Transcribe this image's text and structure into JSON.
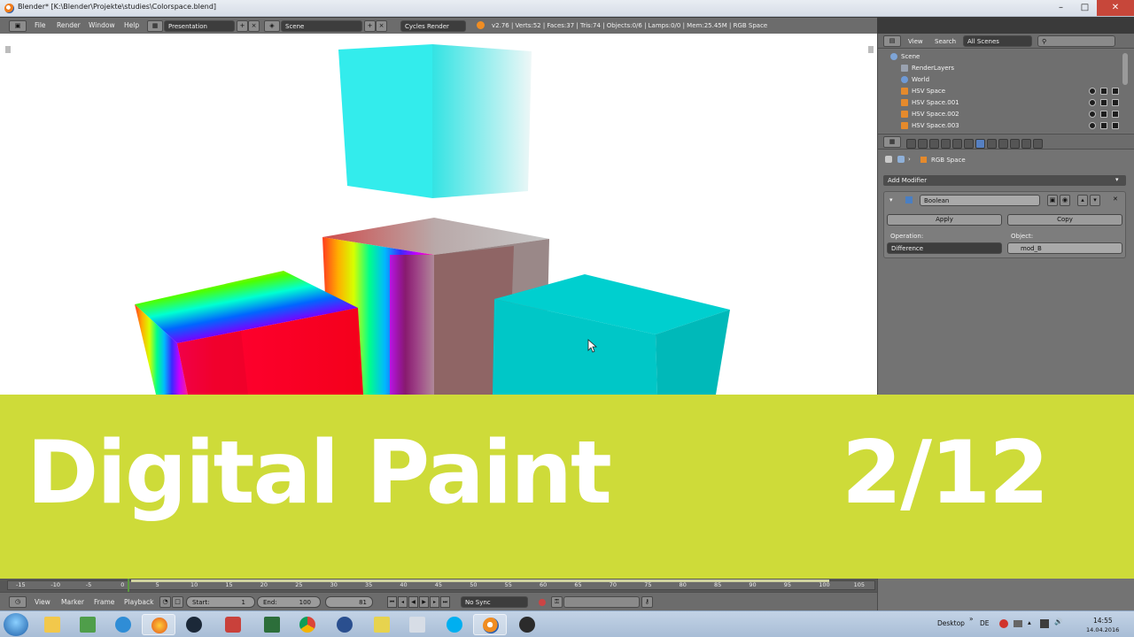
{
  "window": {
    "title": "Blender* [K:\\Blender\\Projekte\\studies\\Colorspace.blend]",
    "minimize": "–",
    "maximize": "□",
    "close": "✕"
  },
  "header": {
    "menus": [
      "File",
      "Render",
      "Window",
      "Help"
    ],
    "screen_layout": "Presentation",
    "scene": "Scene",
    "render_engine": "Cycles Render",
    "stats": "v2.76 | Verts:52 | Faces:37 | Tris:74 | Objects:0/6 | Lamps:0/0 | Mem:25.45M | RGB Space"
  },
  "outliner": {
    "menus": [
      "View",
      "Search"
    ],
    "filter": "All Scenes",
    "search_placeholder": "",
    "items": [
      {
        "label": "Scene",
        "indent": 0
      },
      {
        "label": "RenderLayers",
        "indent": 1
      },
      {
        "label": "World",
        "indent": 1
      },
      {
        "label": "HSV Space",
        "indent": 1
      },
      {
        "label": "HSV Space.001",
        "indent": 1
      },
      {
        "label": "HSV Space.002",
        "indent": 1
      },
      {
        "label": "HSV Space.003",
        "indent": 1
      }
    ]
  },
  "properties": {
    "context_object": "RGB Space",
    "add_modifier": "Add Modifier",
    "modifier_name": "Boolean",
    "apply": "Apply",
    "copy": "Copy",
    "operation_label": "Operation:",
    "operation_value": "Difference",
    "object_label": "Object:",
    "object_value": "mod_B"
  },
  "banner": {
    "title": "Digital Paint",
    "counter": "2/12",
    "color": "#cedb39"
  },
  "timeline": {
    "ticks": [
      "-15",
      "-10",
      "-5",
      "0",
      "5",
      "10",
      "15",
      "20",
      "25",
      "30",
      "35",
      "40",
      "45",
      "50",
      "55",
      "60",
      "65",
      "70",
      "75",
      "80",
      "85",
      "90",
      "95",
      "100",
      "105"
    ],
    "menus": [
      "View",
      "Marker",
      "Frame",
      "Playback"
    ],
    "start": "Start:",
    "start_value": "1",
    "end": "End:",
    "end_value": "100",
    "current_frame": "81",
    "sync": "No Sync"
  },
  "taskbar": {
    "desktop_label": "Desktop",
    "language": "DE",
    "time": "14:55",
    "date": "14.04.2016"
  }
}
